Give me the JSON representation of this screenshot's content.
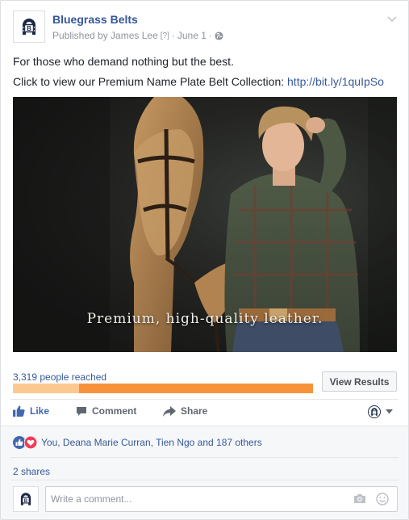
{
  "post": {
    "page_name": "Bluegrass Belts",
    "published_by": "Published by James Lee",
    "help_marker": "[?]",
    "separator": "·",
    "date": "June 1",
    "privacy_icon": "globe-icon",
    "text_line_1": "For those who demand nothing but the best.",
    "text_line_2": "Click to view our Premium Name Plate Belt Collection: ",
    "link": "http://bit.ly/1quIpSo",
    "image_caption": "Premium, high-quality leather."
  },
  "reach": {
    "label": "3,319 people reached",
    "paid_fraction": 0.22,
    "view_results_label": "View Results",
    "colors": {
      "organic": "#fbc98f",
      "paid": "#f7923a"
    }
  },
  "actions": {
    "like": "Like",
    "comment": "Comment",
    "share": "Share"
  },
  "social": {
    "reactions_text": "You, Deana Marie Curran, Tien Ngo and 187 others",
    "shares": "2 shares",
    "comment_placeholder": "Write a comment..."
  },
  "colors": {
    "link": "#365899",
    "like": "#4267b2",
    "love": "#f33e58"
  }
}
